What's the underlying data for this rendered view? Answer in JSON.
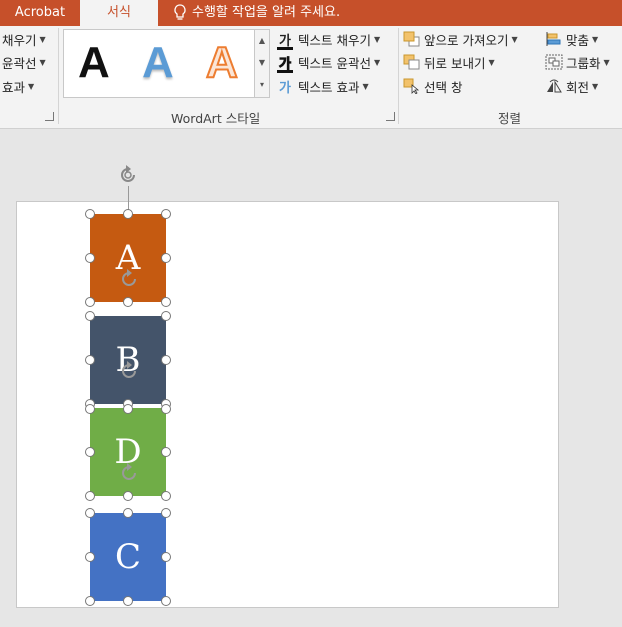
{
  "tabs": {
    "acrobat": "Acrobat",
    "format": "서식"
  },
  "tell_me": "수행할 작업을 알려 주세요.",
  "shape_styles_partial": {
    "fill": "채우기",
    "outline": "윤곽선",
    "effects": "효과"
  },
  "wordart": {
    "samples": [
      "A",
      "A",
      "A"
    ],
    "group_label": "WordArt 스타일",
    "text_fill": "텍스트 채우기",
    "text_outline": "텍스트 윤곽선",
    "text_effects": "텍스트 효과",
    "ga_glyph": "가"
  },
  "arrange": {
    "bring_forward": "앞으로 가져오기",
    "send_backward": "뒤로 보내기",
    "selection_pane": "선택 창",
    "align": "맞춤",
    "group": "그룹화",
    "rotate": "회전",
    "group_label": "정렬"
  },
  "slide_shapes": [
    {
      "label": "A",
      "color": "#c55a11"
    },
    {
      "label": "B",
      "color": "#44546a"
    },
    {
      "label": "D",
      "color": "#70ad47"
    },
    {
      "label": "C",
      "color": "#4472c4"
    }
  ],
  "colors": {
    "ribbon_accent": "#c6502a"
  }
}
